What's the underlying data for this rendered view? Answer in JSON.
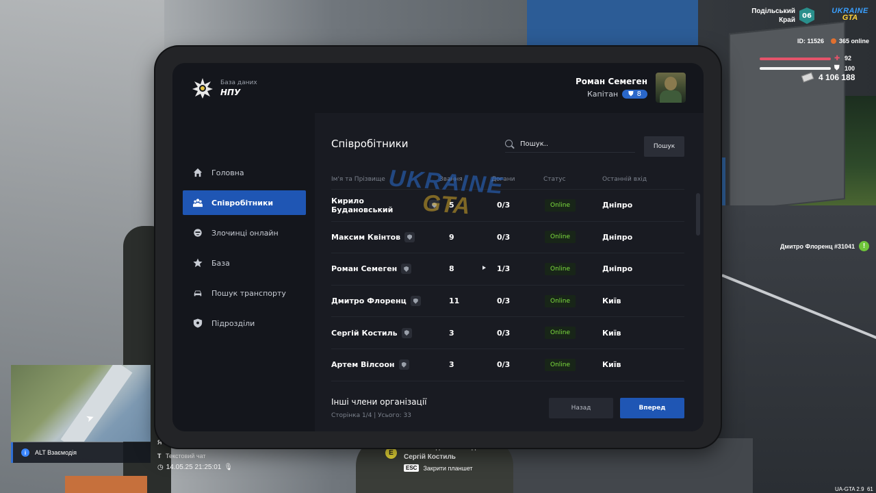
{
  "hud": {
    "region_line1": "Подільський",
    "region_line2": "Край",
    "region_badge": "06",
    "logo_top": "UKRAINE",
    "logo_bottom": "GTA",
    "id_text": "ID: 11526",
    "online_text": "365 online",
    "health": "92",
    "armor": "100",
    "money": "4 106 188",
    "player_tag": "Дмитро Флоренц #31041",
    "alt_hint": "ALT Взаємодія",
    "chat_key": "Т",
    "chat_label": "Текстовий чат",
    "prev_key": "Я",
    "clock": "14.05.25 21:25:01",
    "interact_key": "E",
    "interact_line1": "Затисніть для взаємодії з",
    "interact_line2": "Сергій Костиль",
    "esc_key": "ESC",
    "esc_label": "Закрити планшет",
    "version": "UA-GTA 2.9",
    "version_tail": "61"
  },
  "tablet": {
    "brand_small": "База даних",
    "brand_big": "НПУ",
    "profile_name": "Роман Семеген",
    "profile_rank": "Капітан",
    "profile_level": "8",
    "nav": [
      {
        "label": "Головна",
        "icon": "home-icon"
      },
      {
        "label": "Співробітники",
        "icon": "users-icon"
      },
      {
        "label": "Злочинці онлайн",
        "icon": "criminal-icon"
      },
      {
        "label": "База",
        "icon": "star-icon"
      },
      {
        "label": "Пошук транспорту",
        "icon": "car-icon"
      },
      {
        "label": "Підрозділи",
        "icon": "shield-icon"
      }
    ],
    "title": "Співробітники",
    "search_placeholder": "Пошук..",
    "search_button": "Пошук",
    "columns": {
      "name": "Ім'я та Прізвище",
      "rank": "Звання",
      "reprimands": "Догани",
      "status": "Статус",
      "last_login": "Останній вхід"
    },
    "rows": [
      {
        "name": "Кирило Будановський",
        "rank": "5",
        "reprimands": "0/3",
        "status": "Online",
        "last": "Дніпро"
      },
      {
        "name": "Максим Квінтов",
        "rank": "9",
        "reprimands": "0/3",
        "status": "Online",
        "last": "Дніпро"
      },
      {
        "name": "Роман Семеген",
        "rank": "8",
        "reprimands": "1/3",
        "status": "Online",
        "last": "Дніпро"
      },
      {
        "name": "Дмитро Флоренц",
        "rank": "11",
        "reprimands": "0/3",
        "status": "Online",
        "last": "Київ"
      },
      {
        "name": "Сергій Костиль",
        "rank": "3",
        "reprimands": "0/3",
        "status": "Online",
        "last": "Київ"
      },
      {
        "name": "Артем Вілсоон",
        "rank": "3",
        "reprimands": "0/3",
        "status": "Online",
        "last": "Київ"
      }
    ],
    "footer_title": "Інші члени організації",
    "footer_page": "Сторінка 1/4 | Усього: 33",
    "back_button": "Назад",
    "next_button": "Вперед",
    "watermark_top": "UKRAINE",
    "watermark_bottom": "GTA"
  },
  "colors": {
    "accent": "#1f56b4",
    "online": "#7fe13f",
    "health": "#e5536a"
  }
}
